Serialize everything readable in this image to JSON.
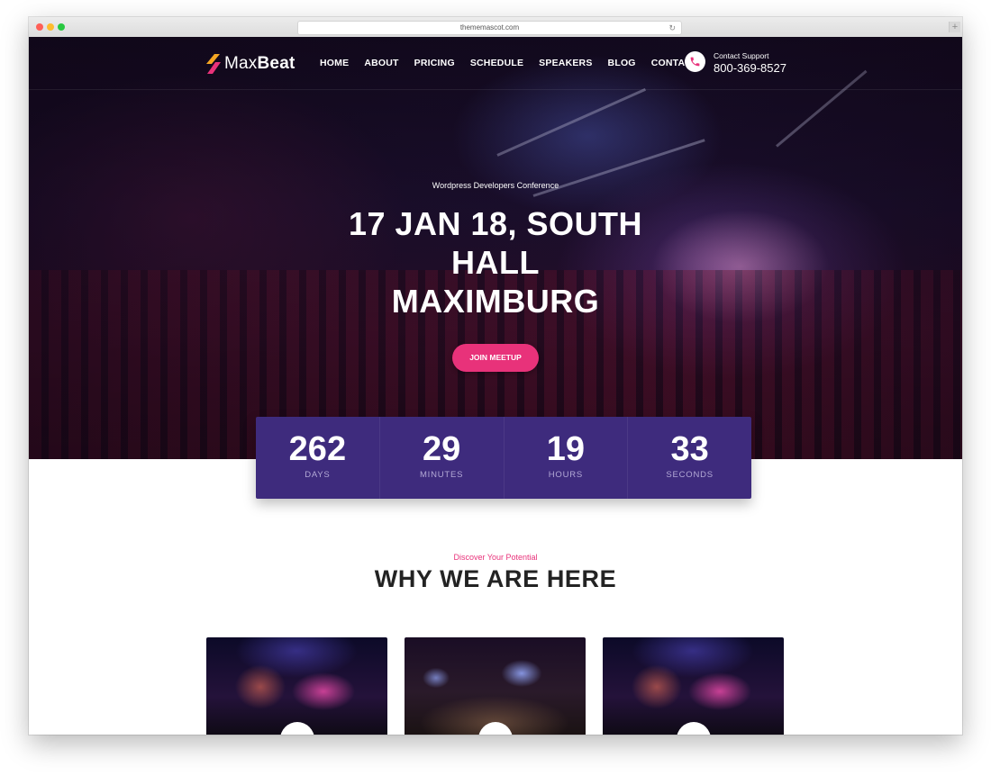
{
  "browser": {
    "url": "thememascot.com",
    "new_tab_label": "+"
  },
  "brand": {
    "name_light": "Max",
    "name_bold": "Beat"
  },
  "nav": {
    "items": [
      "HOME",
      "ABOUT",
      "PRICING",
      "SCHEDULE",
      "SPEAKERS",
      "BLOG",
      "CONTACT"
    ]
  },
  "support": {
    "label": "Contact Support",
    "phone": "800-369-8527"
  },
  "hero": {
    "eyebrow": "Wordpress Developers Conference",
    "headline_line1": "17 JAN 18, SOUTH",
    "headline_line2": "HALL",
    "headline_line3": "MAXIMBURG",
    "cta_label": "JOIN MEETUP"
  },
  "countdown": [
    {
      "value": "262",
      "label": "DAYS"
    },
    {
      "value": "29",
      "label": "MINUTES"
    },
    {
      "value": "19",
      "label": "HOURS"
    },
    {
      "value": "33",
      "label": "SECONDS"
    }
  ],
  "why": {
    "subtitle": "Discover Your Potential",
    "title": "WHY WE ARE HERE"
  },
  "colors": {
    "accent": "#e8327a",
    "countdown_bg": "#3e2b7d",
    "hero_dark": "#1c1030"
  }
}
